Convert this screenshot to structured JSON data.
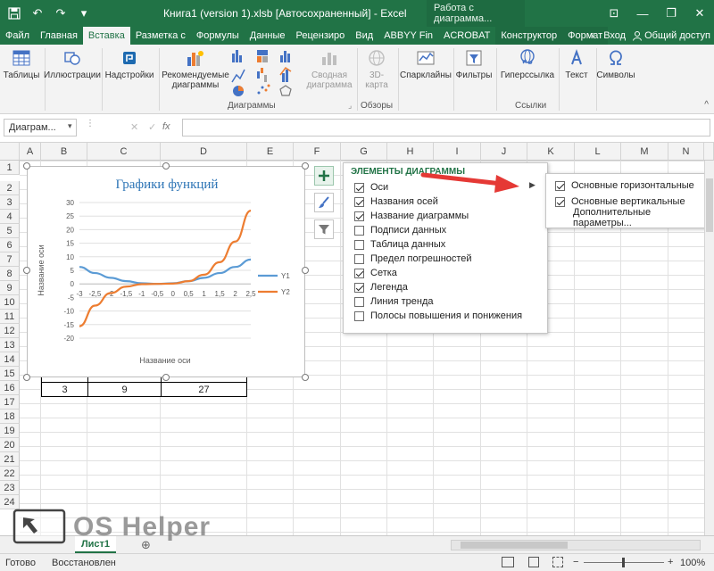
{
  "window": {
    "title": "Книга1 (version 1).xlsb [Автосохраненный] - Excel",
    "context_title": "Работа с диаграмма...",
    "controls": [
      "—",
      "❐",
      "✕"
    ]
  },
  "tabs": [
    {
      "label": "Файл"
    },
    {
      "label": "Главная"
    },
    {
      "label": "Вставка",
      "active": true
    },
    {
      "label": "Разметка с"
    },
    {
      "label": "Формулы"
    },
    {
      "label": "Данные"
    },
    {
      "label": "Рецензиро"
    },
    {
      "label": "Вид"
    },
    {
      "label": "ABBYY Fin"
    },
    {
      "label": "ACROBAT"
    },
    {
      "label": "Конструктор"
    },
    {
      "label": "Формат"
    }
  ],
  "tabs_right": {
    "tell_me": "♀",
    "login": "Вход",
    "share": "Общий доступ"
  },
  "ribbon": {
    "tables": "Таблицы",
    "illustrations": "Иллюстрации",
    "addins": "Надстройки",
    "recommended_charts": "Рекомендуемые диаграммы",
    "pivot_chart": "Сводная диаграмма",
    "map3d": "3D-карта",
    "sparklines": "Спарклайны",
    "filters": "Фильтры",
    "hyperlink": "Гиперссылка",
    "text": "Текст",
    "symbols": "Символы",
    "group_charts": "Диаграммы",
    "group_tours": "Обзоры",
    "group_links": "Ссылки"
  },
  "formula_bar": {
    "name_box": "Диаграм...",
    "fx": "fx",
    "value": ""
  },
  "columns": [
    "A",
    "B",
    "C",
    "D",
    "E",
    "F",
    "G",
    "H",
    "I",
    "J",
    "K",
    "L",
    "M",
    "N"
  ],
  "rows": [
    "1",
    "2",
    "3",
    "4",
    "5",
    "6",
    "7",
    "8",
    "9",
    "10",
    "11",
    "12",
    "13",
    "14",
    "15",
    "16",
    "17",
    "18",
    "19",
    "20",
    "21",
    "22",
    "23",
    "24"
  ],
  "cells": {
    "b15": "3",
    "c15": "9",
    "d15": "27"
  },
  "chart_data": {
    "type": "line",
    "title": "Графики функций",
    "xlabel": "Название оси",
    "ylabel": "Название оси",
    "categories": [
      "-3",
      "-2,5",
      "-2",
      "-1,5",
      "-1",
      "-0,5",
      "0",
      "0,5",
      "1",
      "1,5",
      "2",
      "2,5"
    ],
    "x": [
      -3,
      -2.5,
      -2,
      -1.5,
      -1,
      -0.5,
      0,
      0.5,
      1,
      1.5,
      2,
      2.5
    ],
    "series": [
      {
        "name": "Y1",
        "color": "#5b9bd5",
        "values": [
          6.25,
          4,
          2.25,
          1,
          0.25,
          0,
          0.25,
          1,
          2.25,
          4,
          6.25,
          9
        ]
      },
      {
        "name": "Y2",
        "color": "#ed7d31",
        "values": [
          -15.6,
          -8,
          -3.4,
          -1,
          -0.1,
          0,
          0.1,
          1,
          3.4,
          8,
          15.6,
          27
        ]
      }
    ],
    "yticks": [
      "30",
      "25",
      "20",
      "15",
      "10",
      "5",
      "0",
      "-5",
      "-10",
      "-15",
      "-20"
    ],
    "ylim": [
      -20,
      30
    ],
    "grid": true,
    "legend": "right"
  },
  "elements_panel": {
    "header": "ЭЛЕМЕНТЫ ДИАГРАММЫ",
    "items": [
      {
        "label": "Оси",
        "checked": true
      },
      {
        "label": "Названия осей",
        "checked": true
      },
      {
        "label": "Название диаграммы",
        "checked": true
      },
      {
        "label": "Подписи данных",
        "checked": false
      },
      {
        "label": "Таблица данных",
        "checked": false
      },
      {
        "label": "Предел погрешностей",
        "checked": false
      },
      {
        "label": "Сетка",
        "checked": true
      },
      {
        "label": "Легенда",
        "checked": true
      },
      {
        "label": "Линия тренда",
        "checked": false
      },
      {
        "label": "Полосы повышения и понижения",
        "checked": false
      }
    ]
  },
  "axes_submenu": {
    "items": [
      {
        "label": "Основные горизонтальные",
        "checked": true
      },
      {
        "label": "Основные вертикальные",
        "checked": true
      }
    ],
    "more": "Дополнительные параметры..."
  },
  "sheet": {
    "tab": "Лист1",
    "add": "⊕"
  },
  "watermark": "OS Helper",
  "status": {
    "ready": "Готово",
    "restored": "Восстановлен",
    "zoom": "100%"
  },
  "colors": {
    "excel_green": "#217346",
    "arrow_red": "#e53935"
  }
}
